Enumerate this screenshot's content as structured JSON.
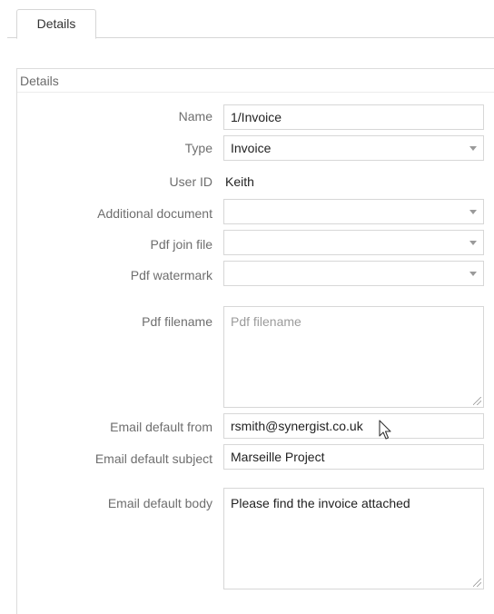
{
  "tabs": [
    {
      "label": "Details",
      "active": true
    }
  ],
  "section": {
    "title": "Details"
  },
  "form": {
    "name": {
      "label": "Name",
      "value": "1/Invoice"
    },
    "type": {
      "label": "Type",
      "value": "Invoice"
    },
    "user_id": {
      "label": "User ID",
      "value": "Keith"
    },
    "additional_document": {
      "label": "Additional document",
      "value": ""
    },
    "pdf_join_file": {
      "label": "Pdf join file",
      "value": ""
    },
    "pdf_watermark": {
      "label": "Pdf watermark",
      "value": ""
    },
    "pdf_filename": {
      "label": "Pdf filename",
      "value": "",
      "placeholder": "Pdf filename"
    },
    "email_default_from": {
      "label": "Email default from",
      "value": "rsmith@synergist.co.uk"
    },
    "email_default_subject": {
      "label": "Email default subject",
      "value": "Marseille Project"
    },
    "email_default_body": {
      "label": "Email default body",
      "value": "Please find the invoice attached"
    }
  },
  "icons": {
    "dropdown": "chevron-down-icon",
    "cursor": "mouse-pointer-icon"
  }
}
